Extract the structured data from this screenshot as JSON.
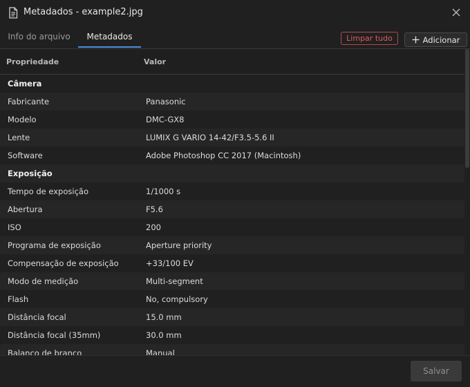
{
  "window": {
    "title": "Metadados - example2.jpg"
  },
  "tabs": [
    {
      "label": "Info do arquivo",
      "active": false
    },
    {
      "label": "Metadados",
      "active": true
    }
  ],
  "toolbar": {
    "clear_label": "Limpar tudo",
    "add_label": "Adicionar"
  },
  "table": {
    "headers": {
      "property": "Propriedade",
      "value": "Valor"
    },
    "rows": [
      {
        "type": "section",
        "property": "Câmera",
        "value": ""
      },
      {
        "type": "item",
        "property": "Fabricante",
        "value": "Panasonic"
      },
      {
        "type": "item",
        "property": "Modelo",
        "value": "DMC-GX8"
      },
      {
        "type": "item",
        "property": "Lente",
        "value": "LUMIX G VARIO 14-42/F3.5-5.6 II"
      },
      {
        "type": "item",
        "property": "Software",
        "value": "Adobe Photoshop CC 2017 (Macintosh)"
      },
      {
        "type": "section",
        "property": "Exposição",
        "value": ""
      },
      {
        "type": "item",
        "property": "Tempo de exposição",
        "value": "1/1000 s"
      },
      {
        "type": "item",
        "property": "Abertura",
        "value": "F5.6"
      },
      {
        "type": "item",
        "property": "ISO",
        "value": "200"
      },
      {
        "type": "item",
        "property": "Programa de exposição",
        "value": "Aperture priority"
      },
      {
        "type": "item",
        "property": "Compensação de exposição",
        "value": "+33/100 EV"
      },
      {
        "type": "item",
        "property": "Modo de medição",
        "value": "Multi-segment"
      },
      {
        "type": "item",
        "property": "Flash",
        "value": "No, compulsory"
      },
      {
        "type": "item",
        "property": "Distância focal",
        "value": "15.0 mm"
      },
      {
        "type": "item",
        "property": "Distância focal (35mm)",
        "value": "30.0 mm"
      },
      {
        "type": "item",
        "property": "Balanço de branco",
        "value": "Manual"
      }
    ]
  },
  "footer": {
    "save_label": "Salvar"
  },
  "colors": {
    "accent": "#4a90e2",
    "danger": "#e05c5c",
    "background": "#202020"
  },
  "icons": {
    "title": "document-icon",
    "close": "close-icon",
    "add": "plus-icon"
  }
}
